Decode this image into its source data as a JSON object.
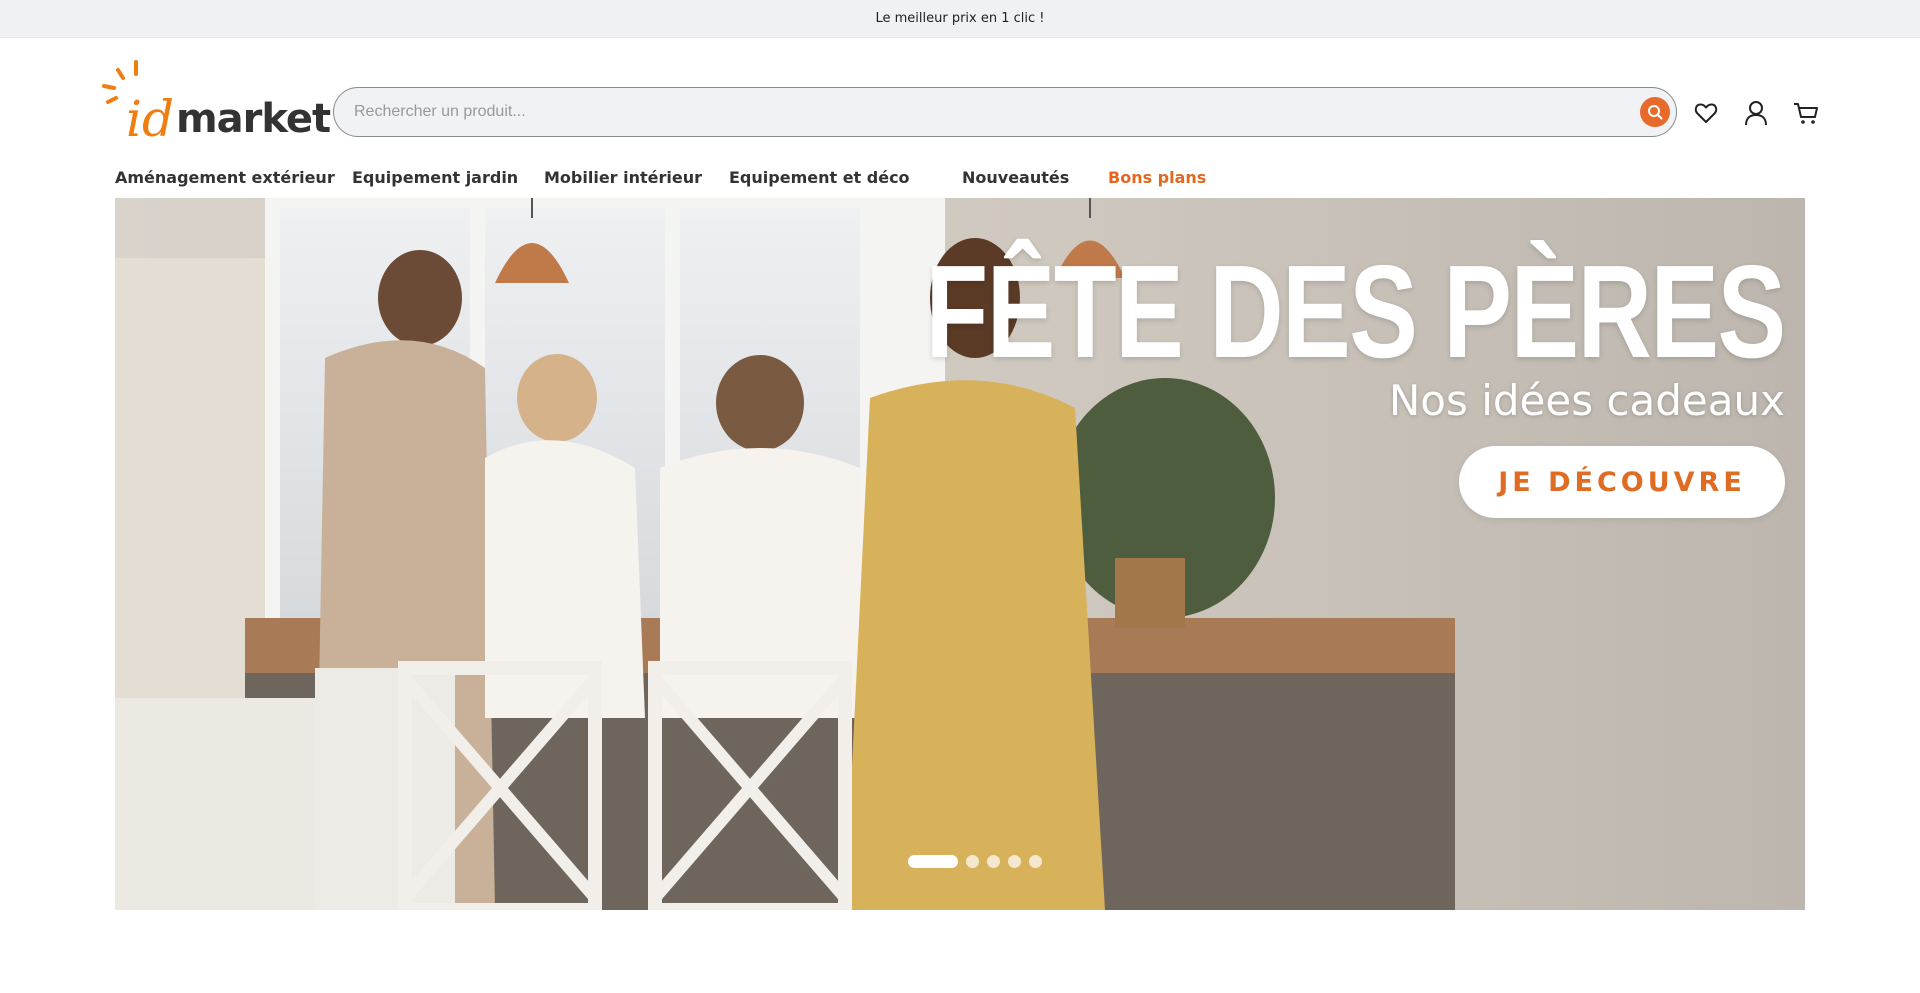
{
  "topbar": {
    "message": "Le meilleur prix en 1 clic !"
  },
  "logo": {
    "prefix": "id",
    "name": "market"
  },
  "search": {
    "placeholder": "Rechercher un produit...",
    "value": ""
  },
  "header_icons": [
    "search-icon",
    "heart-icon",
    "user-icon",
    "cart-icon"
  ],
  "nav": {
    "items": [
      {
        "label": "Aménagement extérieur"
      },
      {
        "label": "Equipement jardin"
      },
      {
        "label": "Mobilier intérieur"
      },
      {
        "label": "Equipement et déco"
      },
      {
        "label": "Nouveautés"
      },
      {
        "label": "Bons plans"
      }
    ]
  },
  "hero": {
    "title": "FÊTE DES PÈRES",
    "subtitle": "Nos idées cadeaux",
    "cta": "JE DÉCOUVRE",
    "slides_total": 5,
    "active_slide": 1
  },
  "colors": {
    "accent": "#e4671f",
    "topbar_bg": "#f0f1f5",
    "search_bg": "#f1f2f6"
  }
}
